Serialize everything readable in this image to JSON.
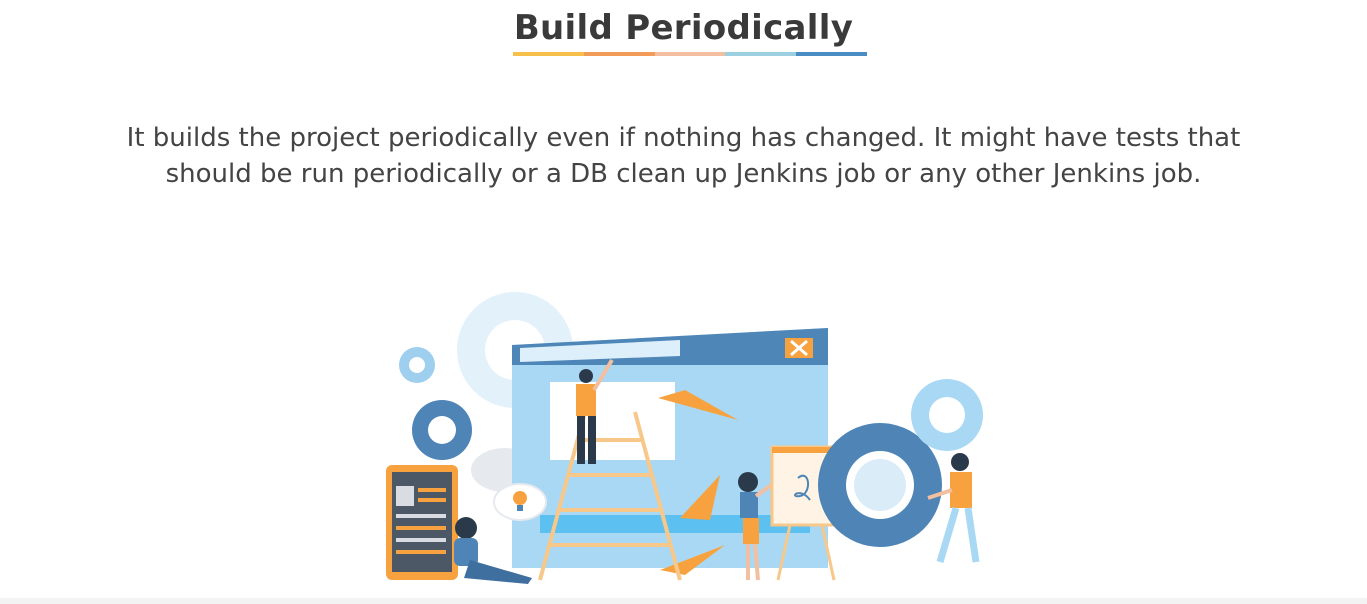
{
  "slide": {
    "title": "Build Periodically",
    "description_line1": "It builds the project periodically even if nothing has changed. It might have tests that",
    "description_line2": "should be run periodically or a DB clean up Jenkins job or any other Jenkins job."
  },
  "colors": {
    "underline": [
      "#f7c04a",
      "#f39c5a",
      "#e88a5a",
      "#9ccfe0",
      "#4a8cc4"
    ],
    "window_blue": "#a9d8f5",
    "window_bar": "#4f86b8",
    "orange": "#f7a23e",
    "gear_dark": "#4e84b6",
    "gear_light": "#d9ecf8"
  },
  "icons": {
    "illustration": "team-working-on-browser-illustration"
  }
}
